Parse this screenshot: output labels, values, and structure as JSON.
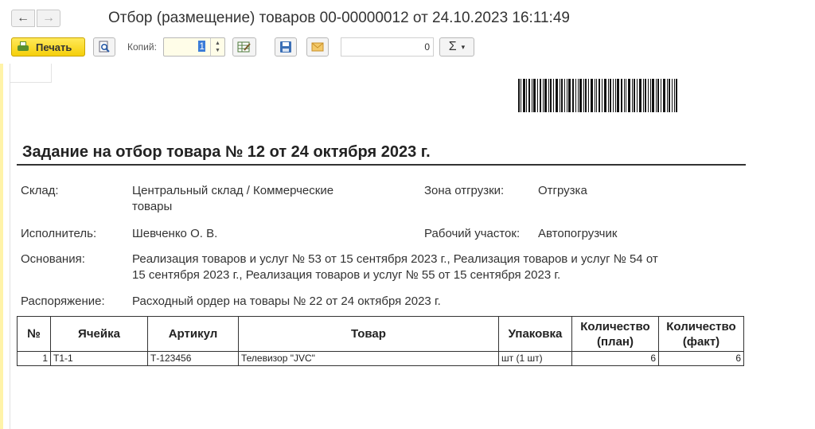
{
  "window": {
    "title": "Отбор (размещение) товаров 00-00000012 от 24.10.2023 16:11:49"
  },
  "nav": {
    "back_icon": "←",
    "forward_icon": "→"
  },
  "toolbar": {
    "print_label": "Печать",
    "copies_label": "Копий:",
    "copies_value": "1",
    "sum_value": "0",
    "sigma_icon": "Σ",
    "sigma_caret": "▾",
    "accent_color": "#f5cf0a"
  },
  "document": {
    "heading": "Задание на отбор товара № 12 от 24 октября 2023 г.",
    "fields": {
      "warehouse_label": "Склад:",
      "warehouse_value_line1": "Центральный склад / Коммерческие",
      "warehouse_value_line2": "товары",
      "zone_label": "Зона отгрузки:",
      "zone_value": "Отгрузка",
      "performer_label": "Исполнитель:",
      "performer_value": "Шевченко О. В.",
      "workplace_label": "Рабочий участок:",
      "workplace_value": "Автопогрузчик",
      "basis_label": "Основания:",
      "basis_value_line1": "Реализация товаров и услуг № 53 от 15 сентября 2023 г., Реализация товаров и услуг № 54 от",
      "basis_value_line2": "15 сентября 2023 г., Реализация товаров и услуг № 55 от 15 сентября 2023 г.",
      "order_label": "Распоряжение:",
      "order_value": "Расходный ордер на товары № 22 от 24 октября 2023 г."
    },
    "table": {
      "headers": {
        "num": "№",
        "cell": "Ячейка",
        "article": "Артикул",
        "product": "Товар",
        "package": "Упаковка",
        "qty_plan_1": "Количество",
        "qty_plan_2": "(план)",
        "qty_fact_1": "Количество",
        "qty_fact_2": "(факт)"
      },
      "rows": [
        {
          "num": "1",
          "cell": "Т1-1",
          "article": "Т-123456",
          "product": "Телевизор \"JVC\"",
          "package": "шт (1 шт)",
          "qty_plan": "6",
          "qty_fact": "6"
        }
      ]
    }
  }
}
